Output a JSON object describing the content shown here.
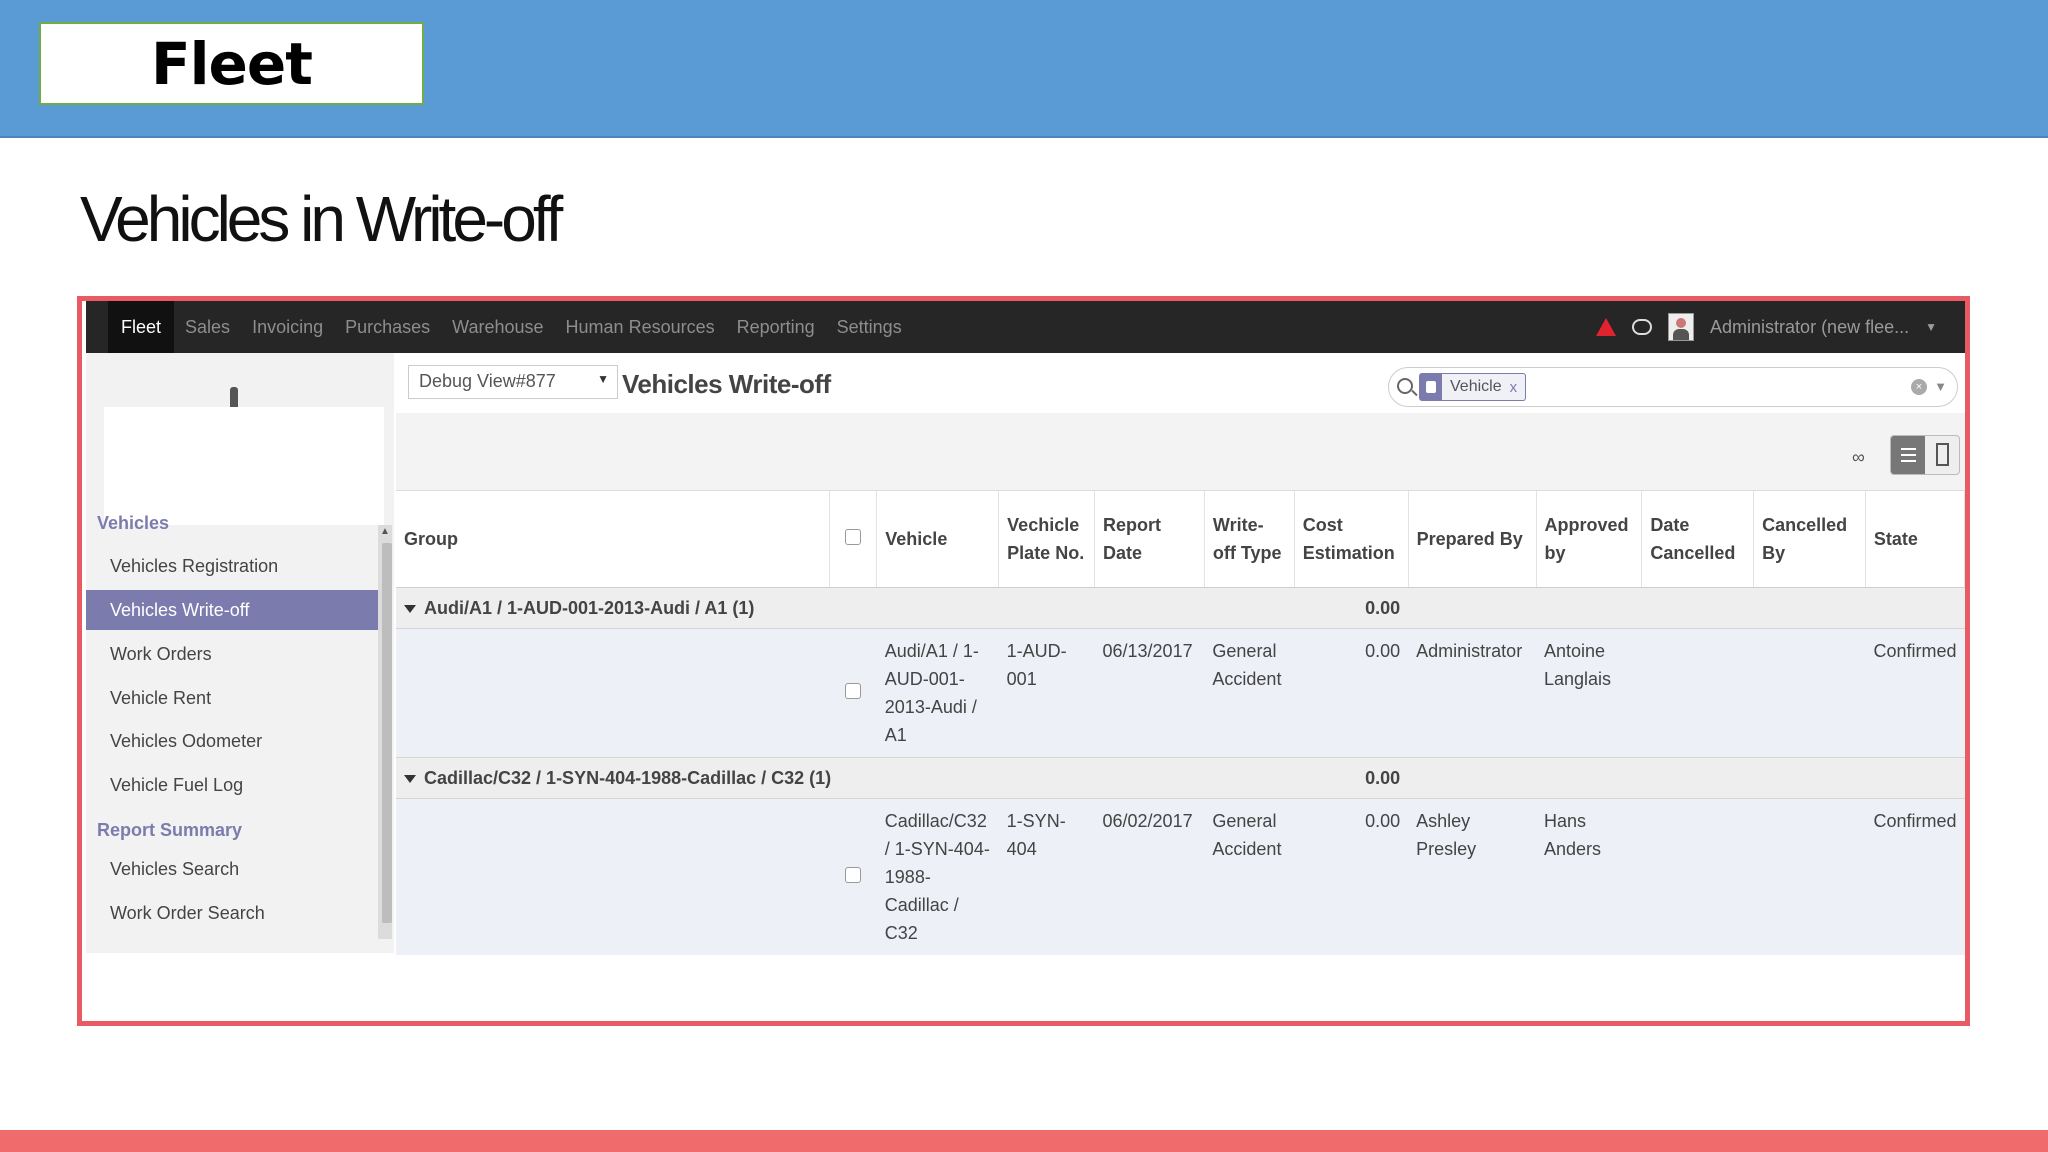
{
  "banner": {
    "title": "Fleet"
  },
  "slide_heading": "Vehicles in Write-off",
  "navbar": {
    "items": [
      "Fleet",
      "Sales",
      "Invoicing",
      "Purchases",
      "Warehouse",
      "Human Resources",
      "Reporting",
      "Settings"
    ],
    "user": "Administrator (new  flee..."
  },
  "sidebar": {
    "section_vehicles": "Vehicles",
    "items": [
      "Vehicles Registration",
      "Vehicles Write-off",
      "Work Orders",
      "Vehicle Rent",
      "Vehicles Odometer",
      "Vehicle Fuel Log"
    ],
    "section_report": "Report Summary",
    "report_items": [
      "Vehicles Search",
      "Work Order Search"
    ]
  },
  "control_panel": {
    "debug_select": "Debug View#877",
    "title": "Vehicles Write-off",
    "facet_label": "Vehicle",
    "facet_close": "x",
    "infinity": "∞"
  },
  "table": {
    "headers": {
      "group": "Group",
      "vehicle": "Vehicle",
      "plate": "Vechicle Plate No.",
      "report_date": "Report Date",
      "writeoff_type": "Write-off Type",
      "cost": "Cost Estimation",
      "prepared_by": "Prepared By",
      "approved_by": "Approved by",
      "date_cancelled": "Date Cancelled",
      "cancelled_by": "Cancelled By",
      "state": "State"
    },
    "groups": [
      {
        "label": "Audi/A1 / 1-AUD-001-2013-Audi / A1 (1)",
        "total": "0.00",
        "row": {
          "vehicle": "Audi/A1 / 1-AUD-001-2013-Audi / A1",
          "plate": "1-AUD-001",
          "report_date": "06/13/2017",
          "writeoff_type": "General Accident",
          "cost": "0.00",
          "prepared_by": "Administrator",
          "approved_by": "Antoine Langlais",
          "state": "Confirmed"
        }
      },
      {
        "label": "Cadillac/C32 / 1-SYN-404-1988-Cadillac / C32 (1)",
        "total": "0.00",
        "row": {
          "vehicle": "Cadillac/C32 / 1-SYN-404-1988-Cadillac / C32",
          "plate": "1-SYN-404",
          "report_date": "06/02/2017",
          "writeoff_type": "General Accident",
          "cost": "0.00",
          "prepared_by": "Ashley Presley",
          "approved_by": "Hans Anders",
          "state": "Confirmed"
        }
      }
    ]
  },
  "colors": {
    "banner": "#5b9bd5",
    "frame": "#ea5a62",
    "accent": "#7c7bad",
    "navbar": "#262626"
  }
}
